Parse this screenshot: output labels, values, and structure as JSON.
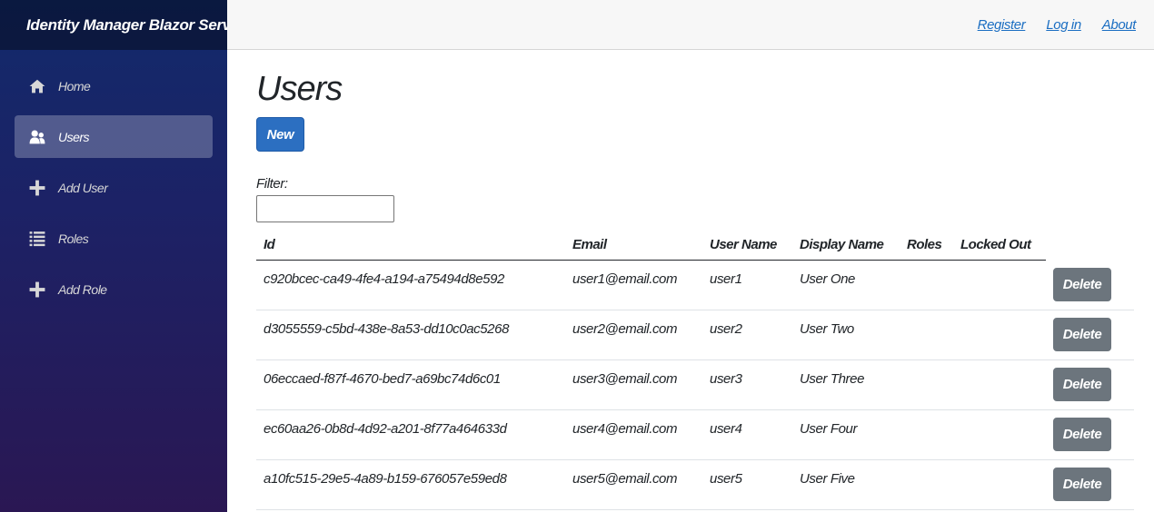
{
  "brand": "Identity Manager Blazor Server",
  "nav": [
    {
      "label": "Home",
      "icon": "home-icon",
      "active": false
    },
    {
      "label": "Users",
      "icon": "users-icon",
      "active": true
    },
    {
      "label": "Add User",
      "icon": "plus-icon",
      "active": false
    },
    {
      "label": "Roles",
      "icon": "list-icon",
      "active": false
    },
    {
      "label": "Add Role",
      "icon": "plus-icon",
      "active": false
    }
  ],
  "top_links": {
    "register": "Register",
    "login": "Log in",
    "about": "About"
  },
  "page": {
    "title": "Users",
    "new_button": "New",
    "filter_label": "Filter:",
    "filter_value": ""
  },
  "table": {
    "headers": {
      "id": "Id",
      "email": "Email",
      "user_name": "User Name",
      "display_name": "Display Name",
      "roles": "Roles",
      "locked_out": "Locked Out"
    },
    "delete_label": "Delete",
    "rows": [
      {
        "id": "c920bcec-ca49-4fe4-a194-a75494d8e592",
        "email": "user1@email.com",
        "user_name": "user1",
        "display_name": "User One",
        "roles": "",
        "locked_out": ""
      },
      {
        "id": "d3055559-c5bd-438e-8a53-dd10c0ac5268",
        "email": "user2@email.com",
        "user_name": "user2",
        "display_name": "User Two",
        "roles": "",
        "locked_out": ""
      },
      {
        "id": "06eccaed-f87f-4670-bed7-a69bc74d6c01",
        "email": "user3@email.com",
        "user_name": "user3",
        "display_name": "User Three",
        "roles": "",
        "locked_out": ""
      },
      {
        "id": "ec60aa26-0b8d-4d92-a201-8f77a464633d",
        "email": "user4@email.com",
        "user_name": "user4",
        "display_name": "User Four",
        "roles": "",
        "locked_out": ""
      },
      {
        "id": "a10fc515-29e5-4a89-b159-676057e59ed8",
        "email": "user5@email.com",
        "user_name": "user5",
        "display_name": "User Five",
        "roles": "",
        "locked_out": ""
      }
    ]
  },
  "colors": {
    "primary": "#2c6fc1",
    "secondary": "#6c757d",
    "link": "#1b6ec2",
    "sidebar_top": "#122a6b",
    "sidebar_bottom": "#2a1753"
  }
}
